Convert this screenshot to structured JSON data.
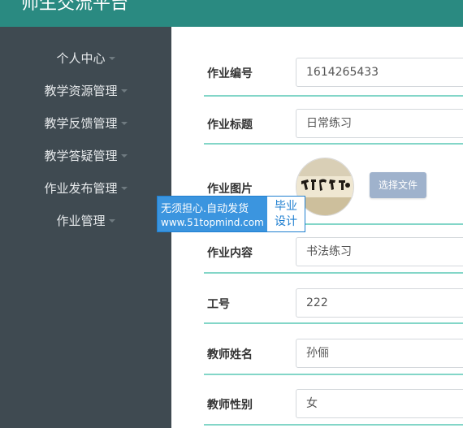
{
  "header": {
    "title": "师生交流平台"
  },
  "sidebar": {
    "items": [
      {
        "label": "个人中心"
      },
      {
        "label": "教学资源管理"
      },
      {
        "label": "教学反馈管理"
      },
      {
        "label": "教学答疑管理"
      },
      {
        "label": "作业发布管理"
      },
      {
        "label": "作业管理"
      }
    ]
  },
  "form": {
    "homework_no": {
      "label": "作业编号",
      "value": "1614265433"
    },
    "homework_title": {
      "label": "作业标题",
      "value": "日常练习"
    },
    "homework_image": {
      "label": "作业图片",
      "button": "选择文件",
      "image_icon": "calligraphy-image"
    },
    "homework_content": {
      "label": "作业内容",
      "value": "书法练习"
    },
    "staff_no": {
      "label": "工号",
      "value": "222"
    },
    "teacher_name": {
      "label": "教师姓名",
      "value": "孙俪"
    },
    "teacher_gender": {
      "label": "教师性别",
      "value": "女"
    }
  },
  "watermark": {
    "line1": "无须担心.自动发货",
    "line2": "www.51topmind.com",
    "right_line1": "毕业",
    "right_line2": "设计"
  },
  "colors": {
    "header": "#2a8a81",
    "sidebar": "#3f4a51",
    "accent_line": "#83d6c8",
    "file_button": "#9fb2cc",
    "watermark_blue": "#3b95df"
  }
}
